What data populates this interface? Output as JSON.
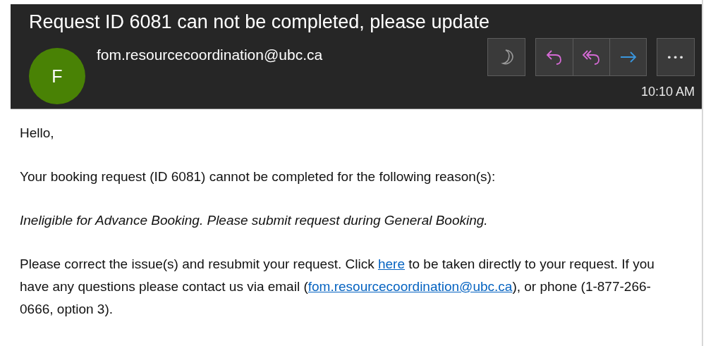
{
  "header": {
    "subject": "Request ID 6081 can not be completed, please update",
    "avatar": {
      "initial": "F",
      "color": "#498205"
    },
    "sender": "fom.resourcecoordination@ubc.ca",
    "time": "10:10 AM",
    "actions": [
      {
        "kind": "moon"
      },
      {
        "kind": "reply"
      },
      {
        "kind": "reply-all"
      },
      {
        "kind": "forward"
      },
      {
        "kind": "more",
        "label": "•••"
      }
    ]
  },
  "body": [
    {
      "kind": "plain",
      "parts": [
        {
          "kind": "text",
          "text": "Hello,"
        }
      ]
    },
    {
      "kind": "plain",
      "parts": [
        {
          "kind": "text",
          "text": "Your booking request (ID 6081) cannot be completed for the following reason(s):"
        }
      ]
    },
    {
      "kind": "italic",
      "parts": [
        {
          "kind": "text",
          "text": "Ineligible for Advance Booking. Please submit request during General Booking."
        }
      ]
    },
    {
      "kind": "plain",
      "parts": [
        {
          "kind": "text",
          "text": "Please correct the issue(s) and resubmit your request. Click "
        },
        {
          "kind": "link",
          "text": "here"
        },
        {
          "kind": "text",
          "text": " to be taken directly to your request. If you have any questions please contact us via email ("
        },
        {
          "kind": "link",
          "text": "fom.resourcecoordination@ubc.ca"
        },
        {
          "kind": "text",
          "text": "), or phone (1-877-266-0666, option 3)."
        }
      ]
    }
  ]
}
